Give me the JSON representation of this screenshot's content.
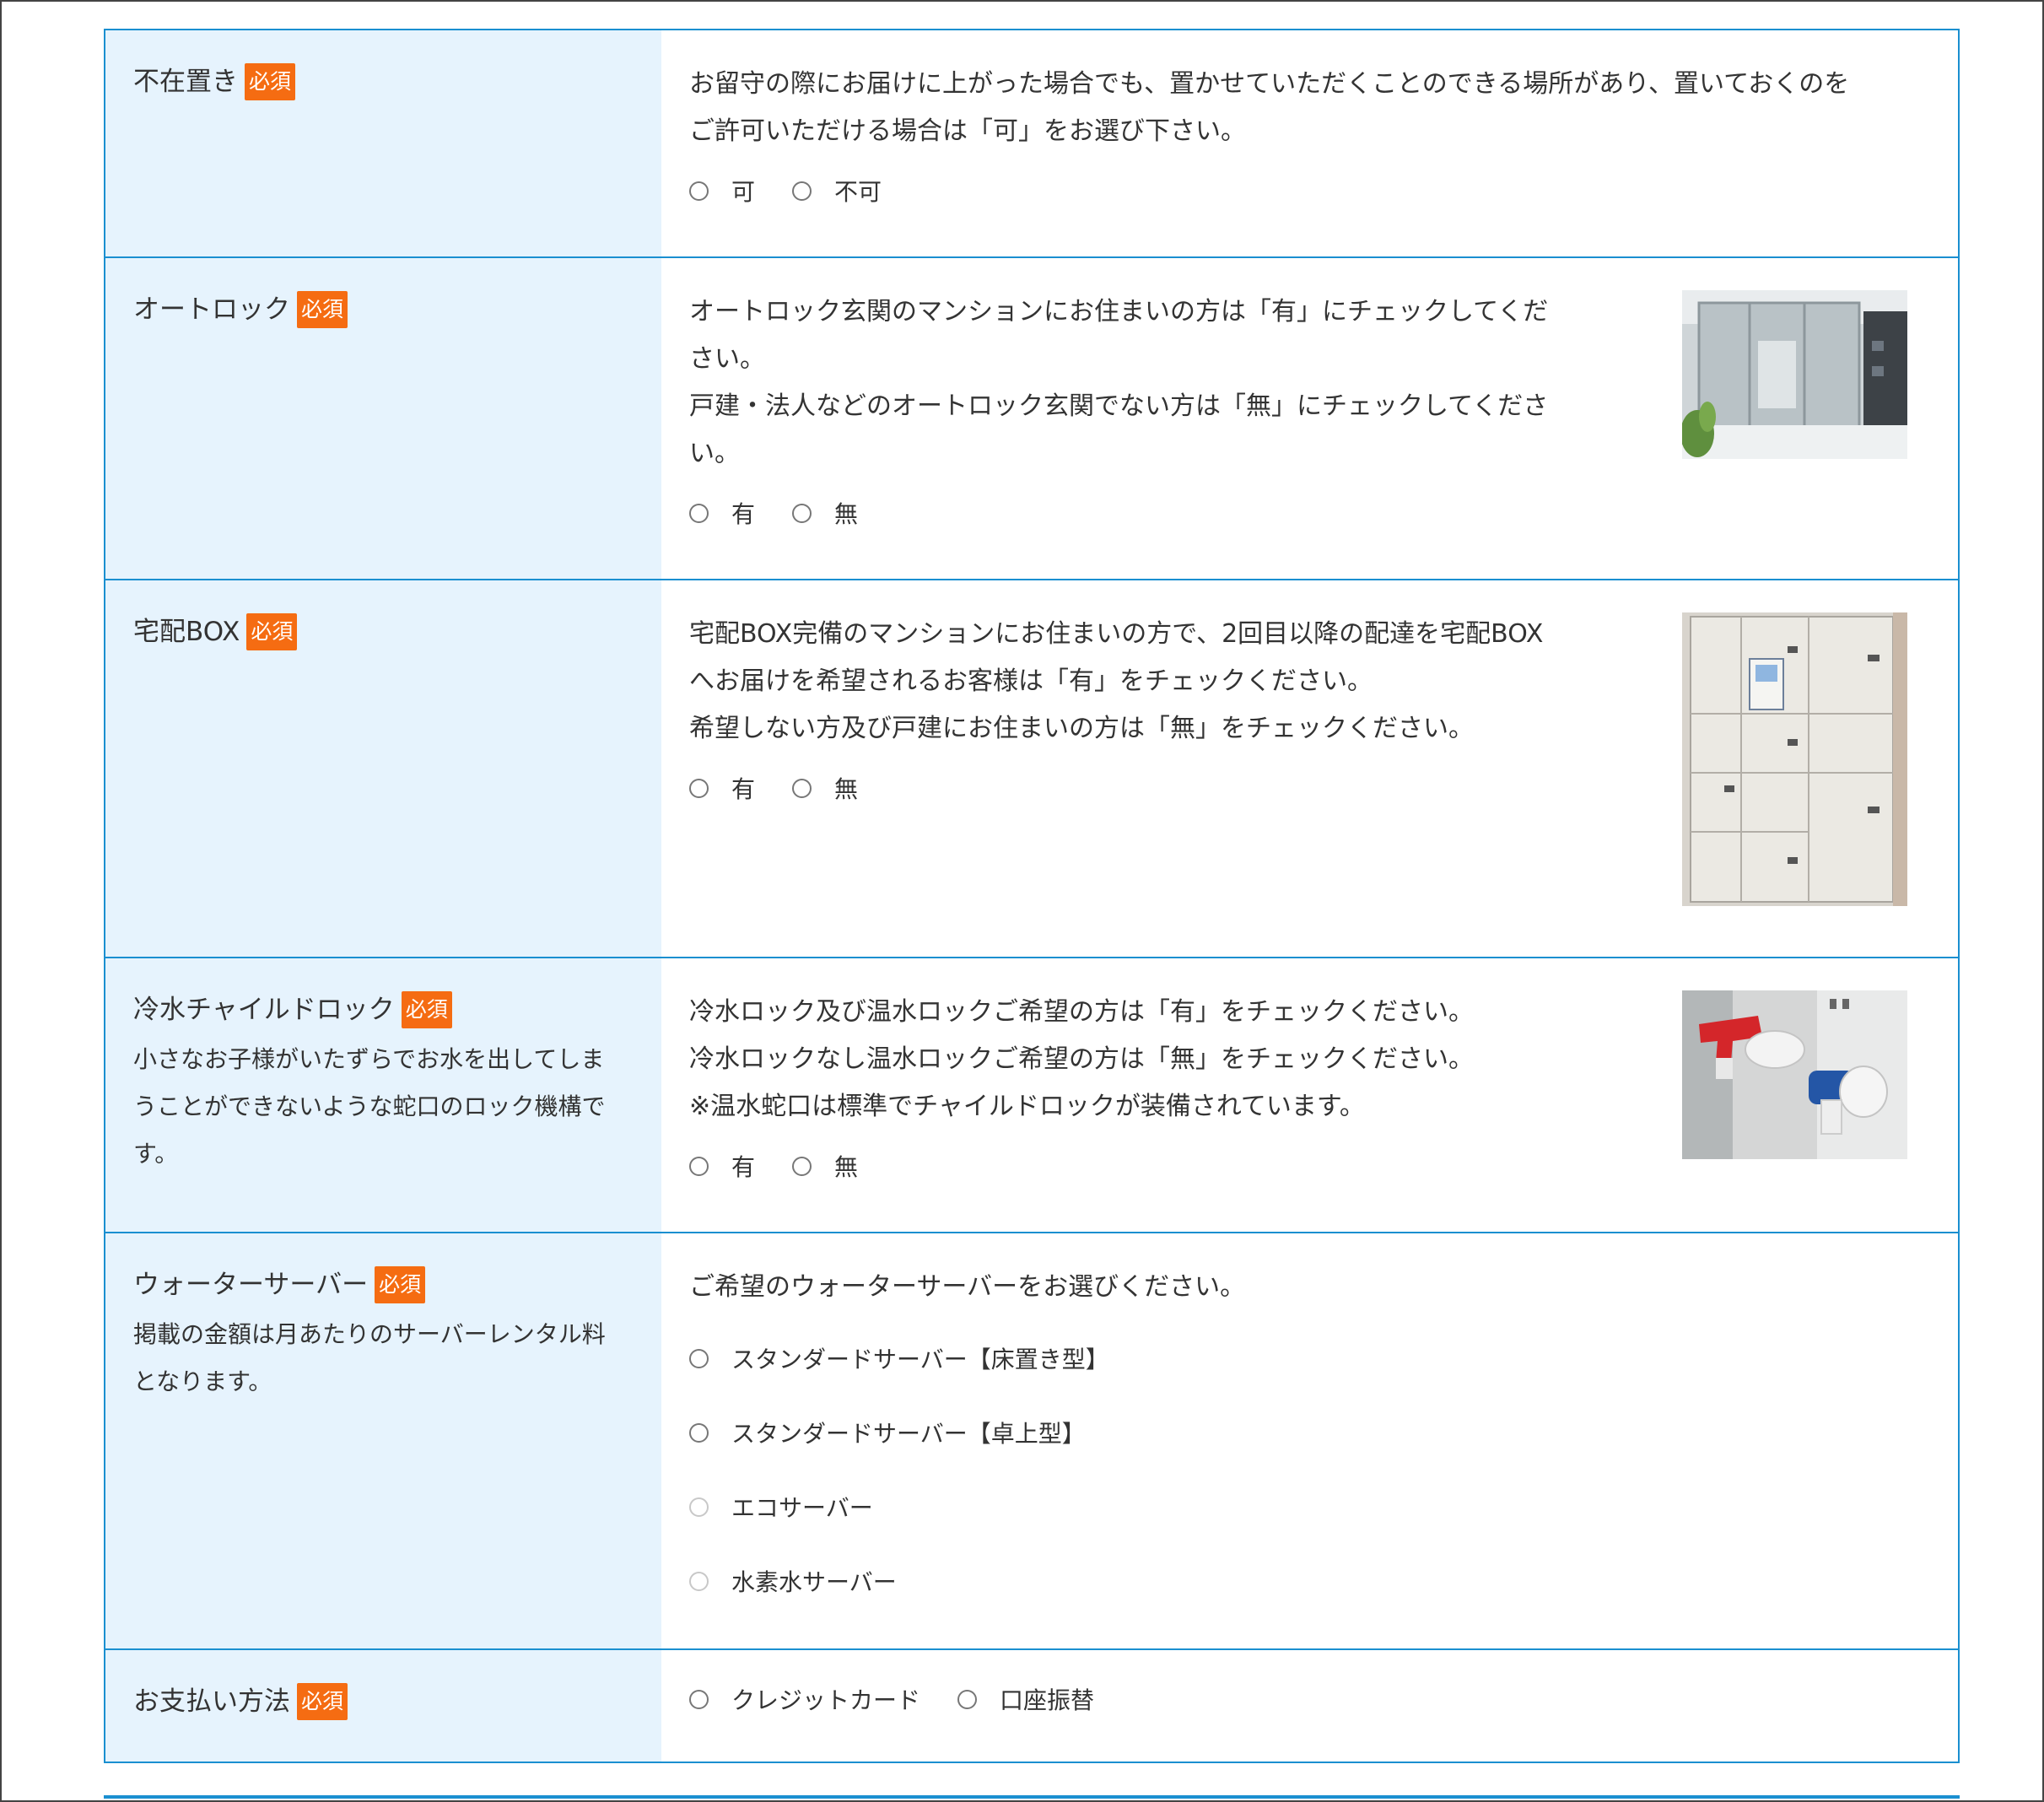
{
  "rows": [
    {
      "label": "不在置き",
      "badge": "必須",
      "desc": [
        "お留守の際にお届けに上がった場合でも、置かせていただくことのできる場所があり、置いておくのを",
        "ご許可いただける場合は「可」をお選び下さい。"
      ],
      "options": [
        "可",
        "不可"
      ]
    },
    {
      "label": "オートロック",
      "badge": "必須",
      "desc": [
        "オートロック玄関のマンションにお住まいの方は「有」にチェックしてくだ",
        "さい。",
        "戸建・法人などのオートロック玄関でない方は「無」にチェックしてくださ",
        "い。"
      ],
      "options": [
        "有",
        "無"
      ],
      "image": "entrance-photo"
    },
    {
      "label": "宅配BOX",
      "badge": "必須",
      "desc": [
        "宅配BOX完備のマンションにお住まいの方で、2回目以降の配達を宅配BOX",
        "へお届けを希望されるお客様は「有」をチェックください。",
        "希望しない方及び戸建にお住まいの方は「無」をチェックください。"
      ],
      "options": [
        "有",
        "無"
      ],
      "image": "delivery-box-photo"
    },
    {
      "label": "冷水チャイルドロック",
      "badge": "必須",
      "note": [
        "小さなお子様がいたずらでお水を出してしま",
        "うことができないような蛇口のロック機構で",
        "す。"
      ],
      "desc": [
        "冷水ロック及び温水ロックご希望の方は「有」をチェックください。",
        "冷水ロックなし温水ロックご希望の方は「無」をチェックください。",
        "※温水蛇口は標準でチャイルドロックが装備されています。"
      ],
      "options": [
        "有",
        "無"
      ],
      "image": "faucet-photo"
    },
    {
      "label": "ウォーターサーバー",
      "badge": "必須",
      "note": [
        "掲載の金額は月あたりのサーバーレンタル料",
        "となります。"
      ],
      "desc": [
        "ご希望のウォーターサーバーをお選びください。"
      ],
      "options": [
        "スタンダードサーバー【床置き型】",
        "スタンダードサーバー【卓上型】",
        "エコサーバー",
        "水素水サーバー"
      ],
      "disabled_options": [
        "エコサーバー",
        "水素水サーバー"
      ]
    },
    {
      "label": "お支払い方法",
      "badge": "必須",
      "options": [
        "クレジットカード",
        "口座振替"
      ]
    }
  ],
  "colors": {
    "border": "#1a8fd0",
    "head_bg": "#e6f3fd",
    "badge": "#f56c12",
    "text": "#333333"
  }
}
